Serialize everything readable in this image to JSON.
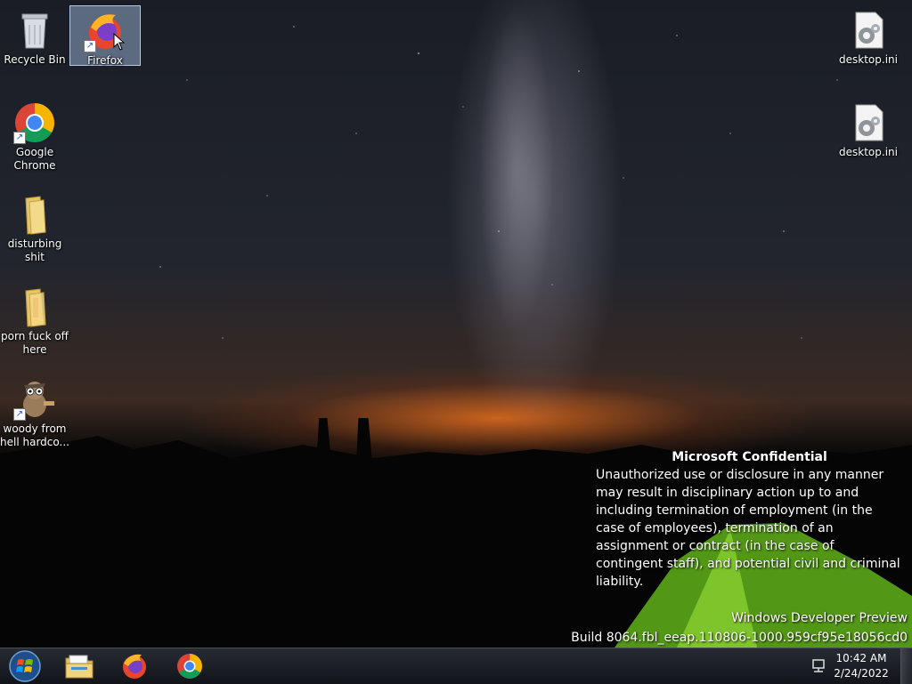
{
  "desktop": {
    "icons": [
      {
        "label": "Recycle Bin",
        "icon": "recycle-bin-icon"
      },
      {
        "label": "Firefox",
        "icon": "firefox-icon"
      },
      {
        "label": "Google Chrome",
        "icon": "chrome-icon"
      },
      {
        "label": "disturbing shit",
        "icon": "folder-icon"
      },
      {
        "label": "porn fuck off here",
        "icon": "folder-icon"
      },
      {
        "label": "woody from hell hardco...",
        "icon": "owl-character-icon"
      },
      {
        "label": "desktop.ini",
        "icon": "settings-file-icon"
      },
      {
        "label": "desktop.ini",
        "icon": "settings-file-icon"
      }
    ]
  },
  "watermark": {
    "title": "Microsoft Confidential",
    "body": "Unauthorized use or disclosure in any manner may result in disciplinary action up to and including termination of employment (in the case of employees), termination of an assignment or contract (in the case of contingent staff), and potential civil and criminal liability.",
    "product": "Windows Developer Preview",
    "build": "Build 8064.fbl_eeap.110806-1000.959cf95e18056cd0"
  },
  "taskbar": {
    "start": "start-orb-icon",
    "pinned": [
      "file-explorer-icon",
      "firefox-icon",
      "chrome-icon"
    ],
    "clock": {
      "time": "10:42 AM",
      "date": "2/24/2022"
    }
  }
}
